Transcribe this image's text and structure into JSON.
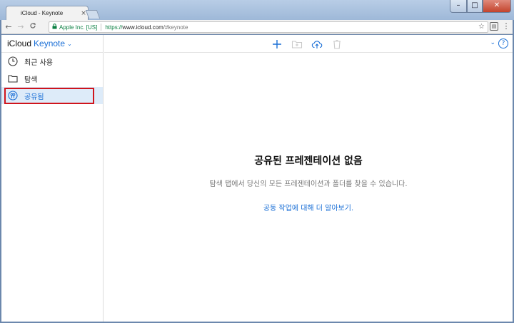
{
  "browser": {
    "tab_title": "iCloud - Keynote",
    "tab_close": "×",
    "window_controls": {
      "minimize": "–",
      "maximize": "□",
      "close": "✕"
    },
    "nav": {
      "back": "←",
      "forward": "→",
      "reload": "C"
    },
    "address": {
      "ev_label": "Apple Inc. [US]",
      "url_scheme": "https://",
      "url_host": "www.icloud.com",
      "url_path": "/#keynote"
    },
    "star": "☆",
    "menu": "⋮"
  },
  "app": {
    "brand_icloud": "iCloud",
    "brand_app": "Keynote",
    "brand_chevron": "⌄"
  },
  "sidebar": {
    "items": [
      {
        "label": "최근 사용",
        "icon": "clock-icon"
      },
      {
        "label": "탐색",
        "icon": "folder-icon"
      },
      {
        "label": "공유됨",
        "icon": "shared-icon"
      }
    ]
  },
  "toolbar": {
    "right_chevron": "⌄",
    "help": "?"
  },
  "empty_state": {
    "title": "공유된 프레젠테이션 없음",
    "description": "탐색 탭에서 당신의 모든 프레젠테이션과 폴더를 찾을 수 있습니다.",
    "link": "공동 작업에 대해 더 알아보기."
  },
  "colors": {
    "accent": "#1a6fd6",
    "highlight_box": "#d0141c",
    "active_item_bg": "#ddebf9"
  }
}
